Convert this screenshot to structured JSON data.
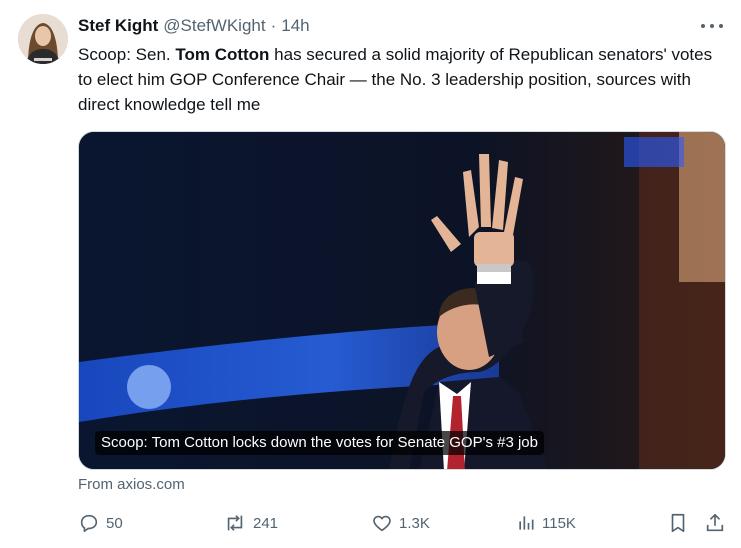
{
  "author": {
    "display_name": "Stef Kight",
    "handle": "@StefWKight",
    "separator": "·",
    "timestamp": "14h",
    "avatar_icon": "profile-photo"
  },
  "tweet": {
    "text_before": "Scoop: Sen. ",
    "text_bold": "Tom Cotton",
    "text_after": " has secured a solid majority of Republican senators' votes to elect him GOP Conference Chair — the No. 3 leadership position, sources with direct knowledge tell me"
  },
  "link_card": {
    "headline": "Scoop: Tom Cotton locks down the votes for Senate GOP's #3 job",
    "source": "From axios.com"
  },
  "metrics": {
    "replies": "50",
    "reposts": "241",
    "likes": "1.3K",
    "views": "115K"
  },
  "icons": {
    "more": "more-horizontal-icon",
    "reply": "reply-bubble-icon",
    "repost": "repost-arrows-icon",
    "like": "heart-icon",
    "views": "bar-chart-icon",
    "bookmark": "bookmark-icon",
    "share": "share-upload-icon"
  },
  "colors": {
    "text_primary": "#0f1419",
    "text_secondary": "#536471",
    "border": "#cfd9de"
  }
}
